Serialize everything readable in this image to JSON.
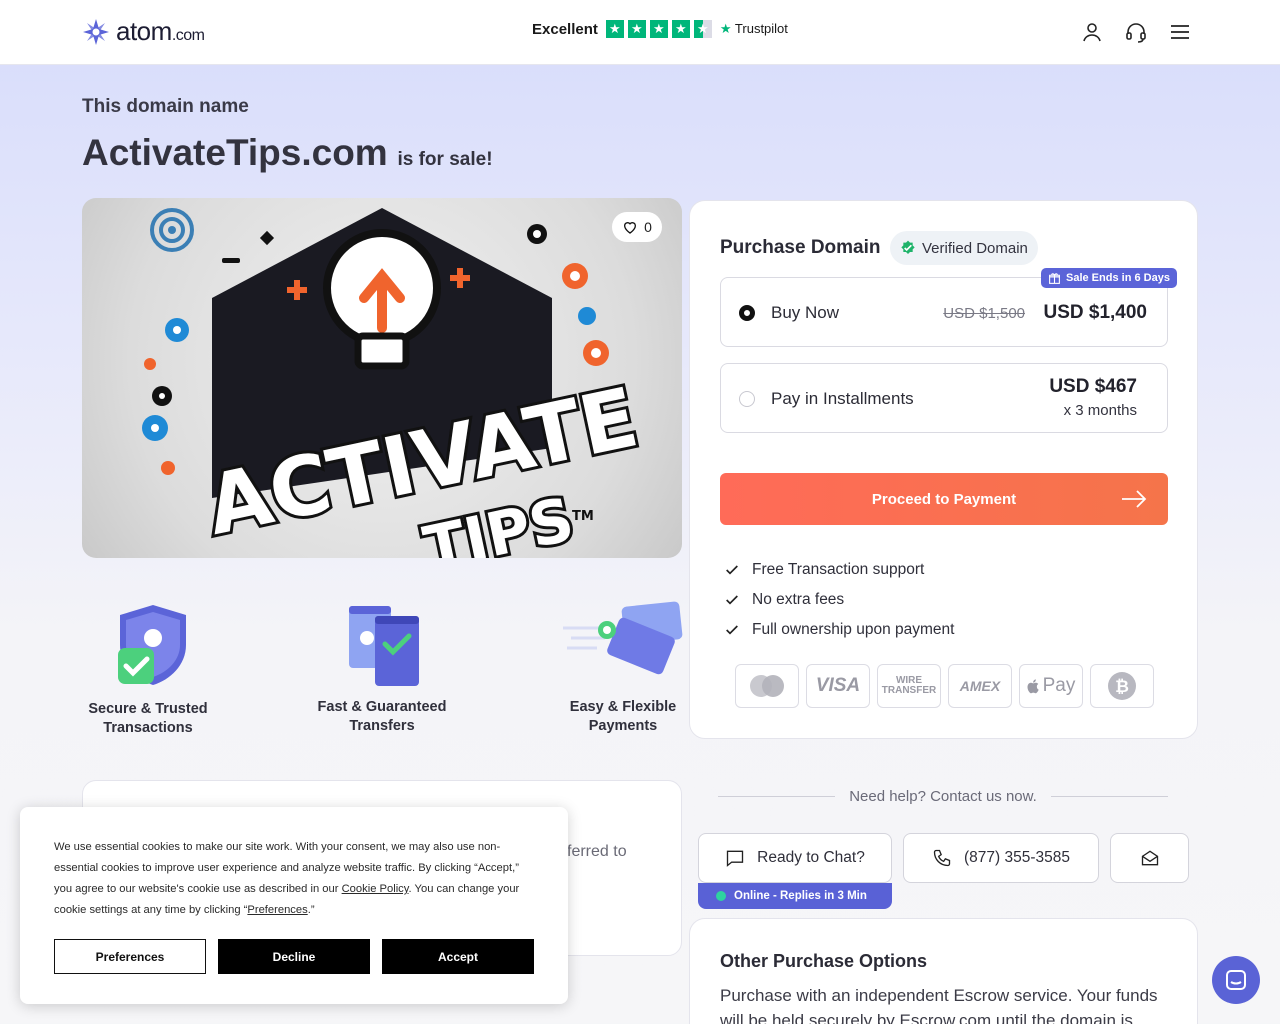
{
  "header": {
    "logo_text": "atom",
    "logo_suffix": ".com",
    "trust_label": "Excellent",
    "trust_brand": "Trustpilot",
    "trust_stars": 4.5
  },
  "intro": {
    "eyebrow": "This domain name",
    "domain": "ActivateTips.com",
    "suffix": "is for sale!"
  },
  "hero": {
    "logo_line1": "ACTIVATE",
    "logo_line2": "TIPS",
    "tm": "TM",
    "favorites": "0"
  },
  "features": [
    {
      "line1": "Secure & Trusted",
      "line2": "Transactions"
    },
    {
      "line1": "Fast & Guaranteed",
      "line2": "Transfers"
    },
    {
      "line1": "Easy & Flexible",
      "line2": "Payments"
    }
  ],
  "purchase": {
    "title": "Purchase Domain",
    "verified": "Verified Domain",
    "sale_badge": "Sale Ends in 6 Days",
    "buy_now": {
      "label": "Buy Now",
      "old_price": "USD $1,500",
      "price": "USD $1,400"
    },
    "installments": {
      "label": "Pay in Installments",
      "price": "USD $467",
      "term": "x 3 months"
    },
    "cta": "Proceed to Payment",
    "perks": [
      "Free Transaction support",
      "No extra fees",
      "Full ownership upon payment"
    ],
    "payment_methods": [
      "mastercard",
      "VISA",
      "WIRE TRANSFER",
      "AMEX",
      "Pay",
      "bitcoin"
    ]
  },
  "left_card": {
    "visible_text": "ferred to"
  },
  "help": {
    "heading": "Need help? Contact us now.",
    "chat": "Ready to Chat?",
    "phone": "(877) 355-3585",
    "online": "Online - Replies in 3 Min"
  },
  "other": {
    "title": "Other Purchase Options",
    "text": "Purchase with an independent Escrow service. Your funds will be held securely by Escrow.com until the domain is"
  },
  "cookie": {
    "text_1": "We use essential cookies to make our site work. With your consent, we may also use non-essential cookies to improve user experience and analyze website traffic. By clicking “Accept,” you agree to our website's cookie use as described in our ",
    "policy_link": "Cookie Policy",
    "text_2": ". You can change your cookie settings at any time by clicking “",
    "prefs_link": "Preferences",
    "text_3": ".”",
    "preferences": "Preferences",
    "decline": "Decline",
    "accept": "Accept"
  },
  "colors": {
    "accent": "#5b64d8",
    "cta": "#ff6b58",
    "trustpilot": "#00b67a",
    "online_dot": "#2ed3a0"
  }
}
